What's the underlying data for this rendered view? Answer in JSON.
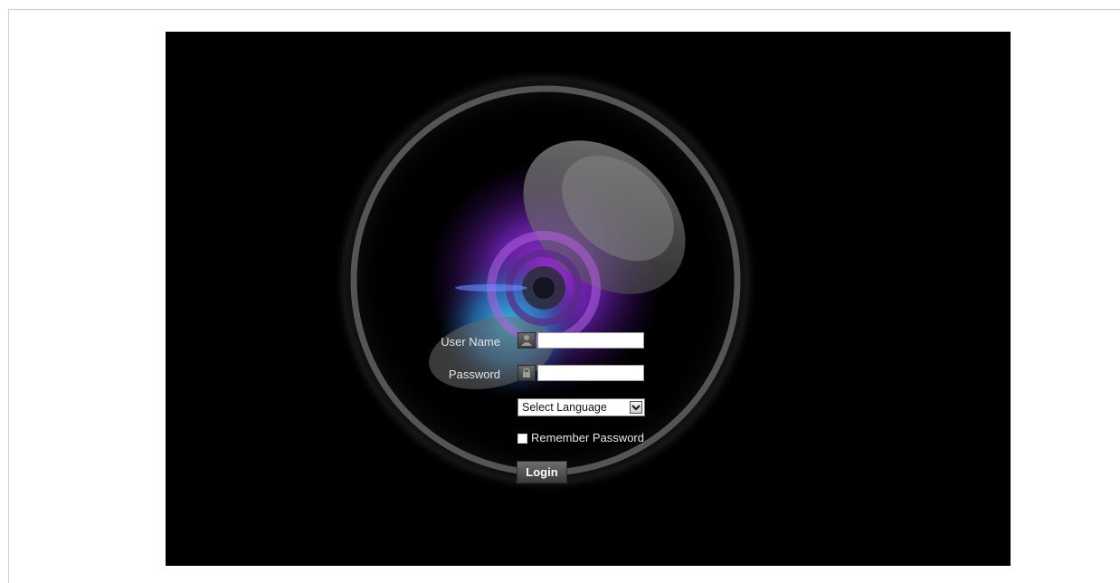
{
  "login_form": {
    "username_label": "User Name",
    "username_value": "",
    "password_label": "Password",
    "password_value": "",
    "language_select": {
      "selected": "Select Language"
    },
    "remember_password": {
      "label": "Remember Password",
      "checked": false
    },
    "login_button": "Login"
  },
  "icons": {
    "username_field": "user-icon",
    "password_field": "lock-icon",
    "language_dropdown": "chevron-down-icon",
    "background": "camera-lens-logo"
  },
  "colors": {
    "stage_background": "#000000",
    "ring": "#555555",
    "label_text": "#e6e6e6",
    "button": "#4a4a4a"
  }
}
